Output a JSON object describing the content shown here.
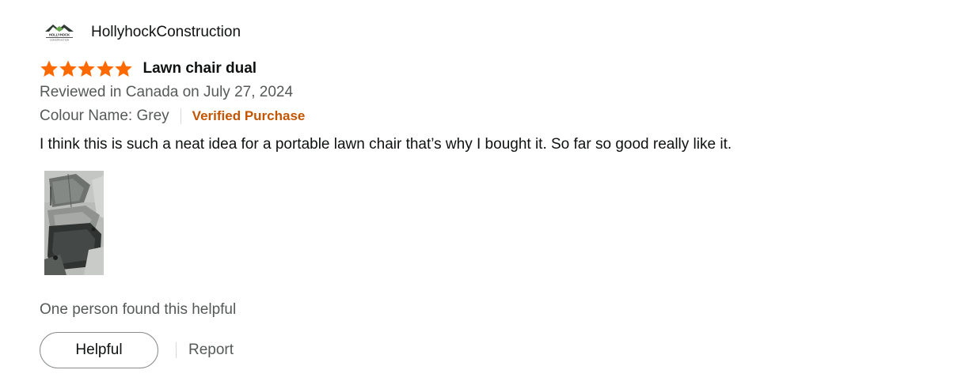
{
  "reviewer": {
    "name": "HollyhockConstruction",
    "avatar_text": "HOLLYHOCK",
    "avatar_subtext": "CONSTRUCTION"
  },
  "review": {
    "rating": 5,
    "rating_max": 5,
    "title": "Lawn chair dual",
    "date_line": "Reviewed in Canada on July 27, 2024",
    "variant": "Colour Name: Grey",
    "verified_label": "Verified Purchase",
    "body": "I think this is such a neat idea for a portable lawn chair that’s why I bought it. So far so good really like it."
  },
  "footer": {
    "helpful_count_text": "One person found this helpful",
    "helpful_button_label": "Helpful",
    "report_label": "Report"
  },
  "colors": {
    "star": "#ff6a00",
    "verified": "#c45500",
    "secondary_text": "#565959"
  }
}
